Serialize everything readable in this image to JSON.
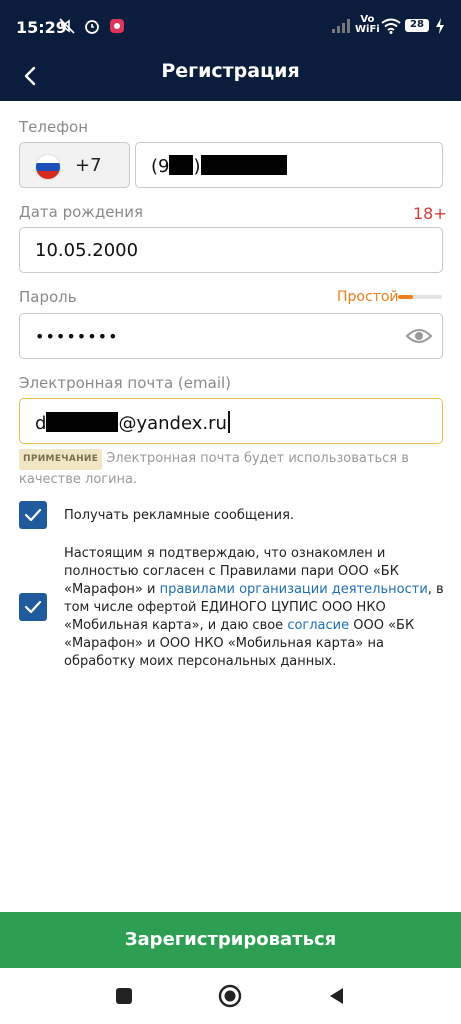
{
  "status": {
    "time": "15:29",
    "vo": "Vo",
    "wifi": "WiFi",
    "battery": "28",
    "icons": [
      "mute-icon",
      "alarm-icon",
      "app-notification-icon",
      "signal-icon",
      "wifi-icon",
      "battery-icon",
      "charging-icon"
    ]
  },
  "appbar": {
    "title": "Регистрация",
    "back_icon": "arrow-left-icon"
  },
  "phone": {
    "label": "Телефон",
    "country_code": "+7",
    "flag": "russia-flag",
    "number_prefix": "(9",
    "number_mid": ")"
  },
  "birthdate": {
    "label": "Дата рождения",
    "age_badge": "18+",
    "value": "10.05.2000"
  },
  "password": {
    "label": "Пароль",
    "strength_text": "Простой",
    "strength_level": 0.35,
    "value": "••••••••",
    "toggle_icon": "eye-icon"
  },
  "email": {
    "label": "Электронная почта (email)",
    "value_prefix": "d",
    "value_suffix": "@yandex.ru"
  },
  "note": {
    "badge": "ПРИМЕЧАНИЕ",
    "text": "Электронная почта будет использоваться в качестве логина."
  },
  "consent_ads": {
    "checked": true,
    "text": "Получать рекламные сообщения."
  },
  "consent_terms": {
    "checked": true,
    "text_1": "Настоящим я подтверждаю, что ознакомлен и полностью согласен с Правилами пари ООО «БК «Марафон» и ",
    "link_1": "правилами организации деятельности",
    "text_2": ", в том числе офертой ЕДИНОГО ЦУПИС ООО НКО «Мобильная карта», и даю свое ",
    "link_2": "согласие",
    "text_3": " ООО «БК «Марафон» и ООО НКО «Мобильная карта» на обработку моих персональных данных."
  },
  "register_button": "Зарегистрироваться",
  "colors": {
    "header": "#0b1d3d",
    "accent_green": "#2c9f52",
    "checkbox": "#1e5a9c",
    "link": "#1f6fb5",
    "age_badge": "#d43c3c",
    "strength": "#f07e1d"
  },
  "navbar": {
    "icons": [
      "recents-square-icon",
      "home-circle-icon",
      "back-triangle-icon"
    ]
  }
}
